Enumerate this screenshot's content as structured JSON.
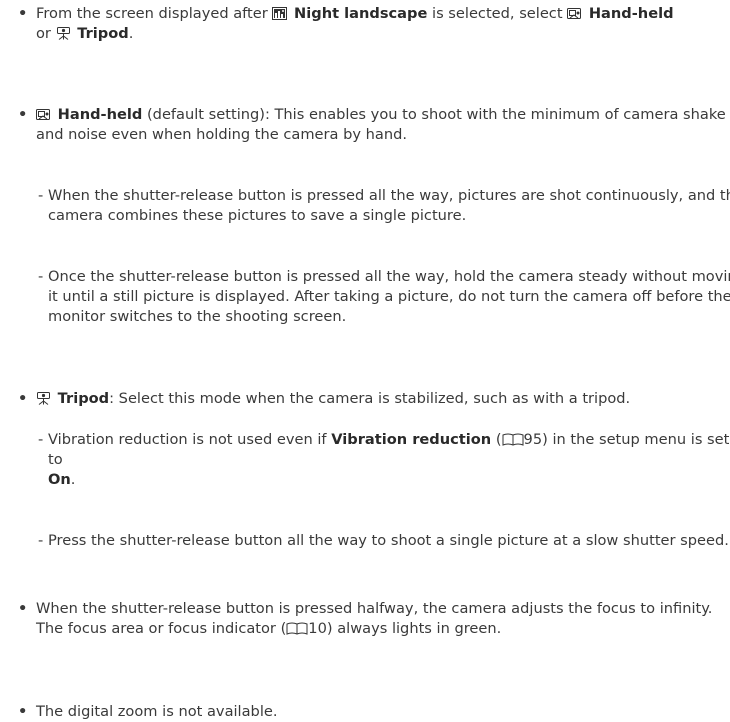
{
  "b1": {
    "t1": "From the screen displayed after",
    "night": "Night landscape",
    "t2": "is selected, select",
    "handheld": "Hand-held",
    "t3": "or",
    "tripod": "Tripod",
    "t4": "."
  },
  "b2": {
    "handheld": "Hand-held",
    "rest": "(default setting): This enables you to shoot with the minimum of camera shake and noise even when holding the camera by hand.",
    "sub1": "When the shutter-release button is pressed all the way, pictures are shot continuously, and the camera combines these pictures to save a single picture.",
    "sub2": "Once the shutter-release button is pressed all the way, hold the camera steady without moving it until a still picture is displayed. After taking a picture, do not turn the camera off before the monitor switches to the shooting screen."
  },
  "b3": {
    "tripod": "Tripod",
    "rest": ": Select this mode when the camera is stabilized, such as with a tripod.",
    "sub1_a": "Vibration reduction is not used even if",
    "sub1_vr": "Vibration reduction",
    "sub1_paren_open": "(",
    "sub1_page": "95",
    "sub1_b": ") in the setup menu is set to",
    "sub1_on": "On",
    "sub1_end": ".",
    "sub2": "Press the shutter-release button all the way to shoot a single picture at a slow shutter speed."
  },
  "b4": {
    "t1": "When the shutter-release button is pressed halfway, the camera adjusts the focus to infinity. The focus area or focus indicator (",
    "page": "10",
    "t2": ") always lights in green."
  },
  "b5": {
    "text": "The digital zoom is not available."
  },
  "icons": {
    "night": "night-landscape-icon",
    "handheld": "hand-held-icon",
    "tripod": "tripod-icon",
    "book": "book-reference-icon"
  }
}
